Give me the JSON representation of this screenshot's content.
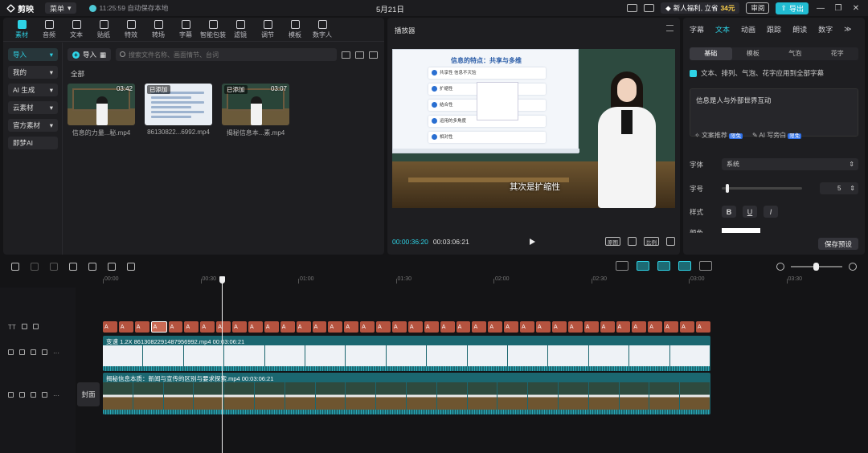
{
  "titlebar": {
    "app_name": "剪映",
    "menu_label": "菜单",
    "autosave": "11:25:59 自动保存本地",
    "date": "5月21日",
    "promo_prefix": "新人福利, 立省",
    "promo_amount": "34元",
    "review_label": "审阅",
    "export_label": "导出"
  },
  "media": {
    "tabs": [
      {
        "label": "素材",
        "icon": "media-icon"
      },
      {
        "label": "音频",
        "icon": "audio-icon"
      },
      {
        "label": "文本",
        "icon": "text-icon"
      },
      {
        "label": "贴纸",
        "icon": "sticker-icon"
      },
      {
        "label": "特效",
        "icon": "effects-icon"
      },
      {
        "label": "转场",
        "icon": "transition-icon"
      },
      {
        "label": "字幕",
        "icon": "caption-icon"
      },
      {
        "label": "智能包装",
        "icon": "smart-package-icon"
      },
      {
        "label": "滤镜",
        "icon": "filter-icon"
      },
      {
        "label": "调节",
        "icon": "adjust-icon"
      },
      {
        "label": "模板",
        "icon": "template-icon"
      },
      {
        "label": "数字人",
        "icon": "digital-human-icon"
      }
    ],
    "sidebar": [
      "导入",
      "我的",
      "AI 生成",
      "云素材",
      "官方素材",
      "即梦AI"
    ],
    "import_label": "导入",
    "search_placeholder": "搜索文件名称、画面情节、台词",
    "all_label": "全部",
    "clips": [
      {
        "name": "信息的力量...秘.mp4",
        "duration": "03:42",
        "added": "",
        "kind": "video"
      },
      {
        "name": "86130822...6992.mp4",
        "duration": "",
        "added": "已添加",
        "kind": "doc"
      },
      {
        "name": "揭秘信息本...素.mp4",
        "duration": "03:07",
        "added": "已添加",
        "kind": "video"
      }
    ]
  },
  "player": {
    "title": "播放器",
    "slide_title": "信息的特点：共享与多维",
    "slide_rows": [
      "共享性 信息不灭验",
      "扩缩性",
      "结合性",
      "运用的多角度",
      "相对性"
    ],
    "subtitle": "其次是扩缩性",
    "current_time": "00:00:36:20",
    "total_time": "00:03:06:21",
    "btn_original": "原图",
    "btn_ratio": "比例"
  },
  "props": {
    "tabs": [
      "字幕",
      "文本",
      "动画",
      "跟踪",
      "朗读",
      "数字"
    ],
    "subtabs": [
      "基础",
      "模板",
      "气泡",
      "花字"
    ],
    "apply_all": "文本、排列、气泡、花字应用到全部字幕",
    "text_value": "信息是人与外部世界互动",
    "recommend_label": "文案推荐",
    "ai_write_label": "AI 写旁白",
    "free_badge": "限免",
    "font_label": "字体",
    "font_value": "系统",
    "size_label": "字号",
    "size_value": "5",
    "size_fraction": 0.05,
    "style_label": "样式",
    "style_bold": "B",
    "style_underline": "U",
    "style_italic": "I",
    "color_label": "颜色",
    "save_preset": "保存预设"
  },
  "timeline": {
    "ruler": [
      "00:00",
      "00:30",
      "01:00",
      "01:30",
      "02:00",
      "02:30",
      "03:00",
      "03:30"
    ],
    "text_chips": [
      "A",
      "A",
      "A",
      "A",
      "A",
      "A",
      "A",
      "A",
      "A",
      "A",
      "A",
      "A",
      "A",
      "A",
      "A",
      "A",
      "A",
      "A",
      "A",
      "A",
      "A",
      "A",
      "A",
      "A",
      "A",
      "A",
      "A",
      "A",
      "A",
      "A",
      "A",
      "A",
      "A",
      "A",
      "A",
      "A",
      "A",
      "A"
    ],
    "track1_label": "变速 1.2X  86130822914879569​92.mp4   00:03:06:21",
    "track2_label": "揭秘信息本质：新闻与宣传的区别与要求探索.mp4   00:03:06:21",
    "cover_label": "封面"
  },
  "colors": {
    "accent": "#2ed3e6",
    "text_chip": "#b5533f",
    "video_track": "#1b6770"
  }
}
